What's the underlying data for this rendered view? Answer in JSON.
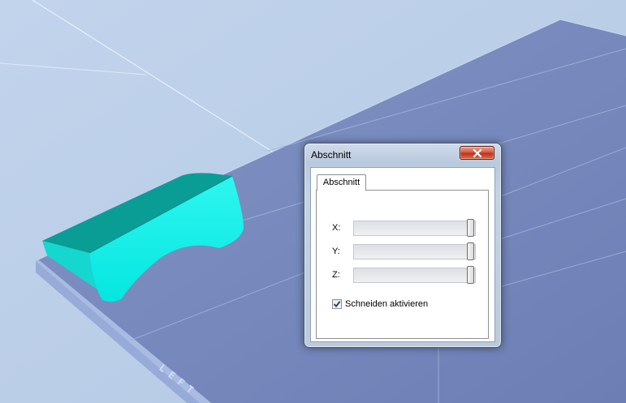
{
  "dialog": {
    "title": "Abschnitt",
    "close_icon": "close-icon",
    "tabs": [
      {
        "label": "Abschnitt",
        "active": true
      }
    ],
    "sliders": [
      {
        "axis": "X:",
        "value": 1.0
      },
      {
        "axis": "Y:",
        "value": 1.0
      },
      {
        "axis": "Z:",
        "value": 1.0
      }
    ],
    "checkbox": {
      "label": "Schneiden aktivieren",
      "checked": true
    }
  },
  "viewport": {
    "plate_edge_text": "LEFT",
    "colors": {
      "background": "#bccfe8",
      "plate_top": "#7b8fc0",
      "plate_side": "#9aaedb",
      "object_front": "#12f2ec",
      "object_top": "#0c9a93"
    }
  }
}
